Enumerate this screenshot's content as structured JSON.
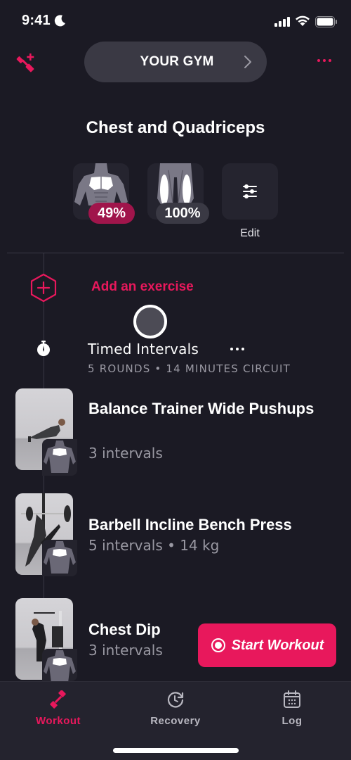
{
  "status_bar": {
    "time": "9:41",
    "focus_icon": "moon-icon",
    "signal_icon": "cellular-signal-icon",
    "wifi_icon": "wifi-icon",
    "battery_icon": "battery-full-icon"
  },
  "header": {
    "left_icon": "add-dumbbell-icon",
    "gym_label": "YOUR GYM",
    "gym_chevron_icon": "chevron-right-icon",
    "right_icon": "more-horizontal-icon"
  },
  "workout": {
    "title": "Chest and Quadriceps",
    "muscle_groups": [
      {
        "name": "Chest",
        "recovery_percent": "49%",
        "badge_color": "#a0154b"
      },
      {
        "name": "Quadriceps",
        "recovery_percent": "100%",
        "badge_color": "#3a3944"
      }
    ],
    "edit_label": "Edit",
    "edit_icon": "sliders-icon"
  },
  "add_exercise": {
    "icon": "hexagon-plus-icon",
    "label": "Add an exercise"
  },
  "block": {
    "icon": "stopwatch-icon",
    "title": "Timed Intervals",
    "subtitle": "5 ROUNDS • 14 MINUTES CIRCUIT",
    "more_icon": "more-horizontal-icon"
  },
  "exercises": [
    {
      "name": "Balance Trainer Wide Pushups",
      "meta": "3 intervals",
      "target_muscle": "chest"
    },
    {
      "name": "Barbell Incline Bench Press",
      "meta": "5 intervals • 14 kg",
      "target_muscle": "chest"
    },
    {
      "name": "Chest Dip",
      "meta": "3 intervals",
      "target_muscle": "chest"
    }
  ],
  "start_button": {
    "label": "Start Workout",
    "icon": "record-icon"
  },
  "tab_bar": {
    "tabs": [
      {
        "label": "Workout",
        "icon": "dumbbell-icon",
        "active": true
      },
      {
        "label": "Recovery",
        "icon": "recovery-clock-icon",
        "active": false
      },
      {
        "label": "Log",
        "icon": "calendar-icon",
        "active": false
      }
    ]
  },
  "colors": {
    "accent": "#e8185c",
    "background": "#1b1a24",
    "surface": "#25242f",
    "pill": "#3a3944",
    "muted_text": "#9a99a3"
  }
}
